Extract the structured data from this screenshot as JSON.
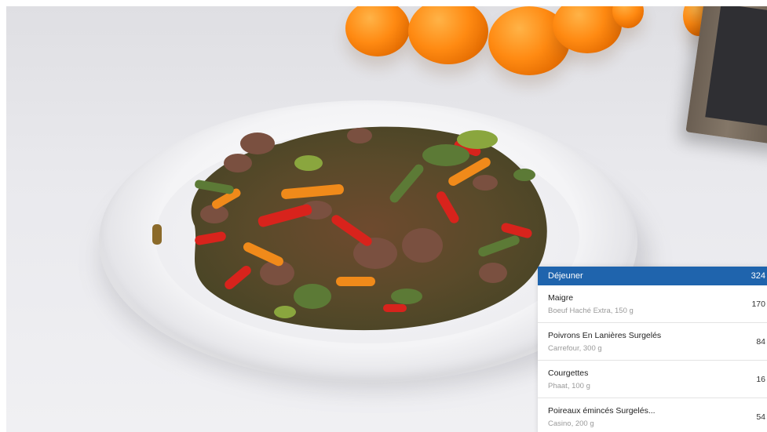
{
  "meal": {
    "title": "Déjeuner",
    "total_calories": "324",
    "header_color": "#1f64ad"
  },
  "items": [
    {
      "name": "Maigre",
      "detail": "Boeuf Haché Extra, 150 g",
      "calories": "170"
    },
    {
      "name": "Poivrons En Lanières Surgelés",
      "detail": "Carrefour, 300 g",
      "calories": "84"
    },
    {
      "name": "Courgettes",
      "detail": "Phaat, 100 g",
      "calories": "16"
    },
    {
      "name": "Poireaux émincés Surgelés...",
      "detail": "Casino, 200 g",
      "calories": "54"
    }
  ],
  "scene": {
    "subject": "plate-of-stir-fried-beef-and-vegetables",
    "background_objects": [
      "oranges",
      "picture-frame"
    ]
  }
}
